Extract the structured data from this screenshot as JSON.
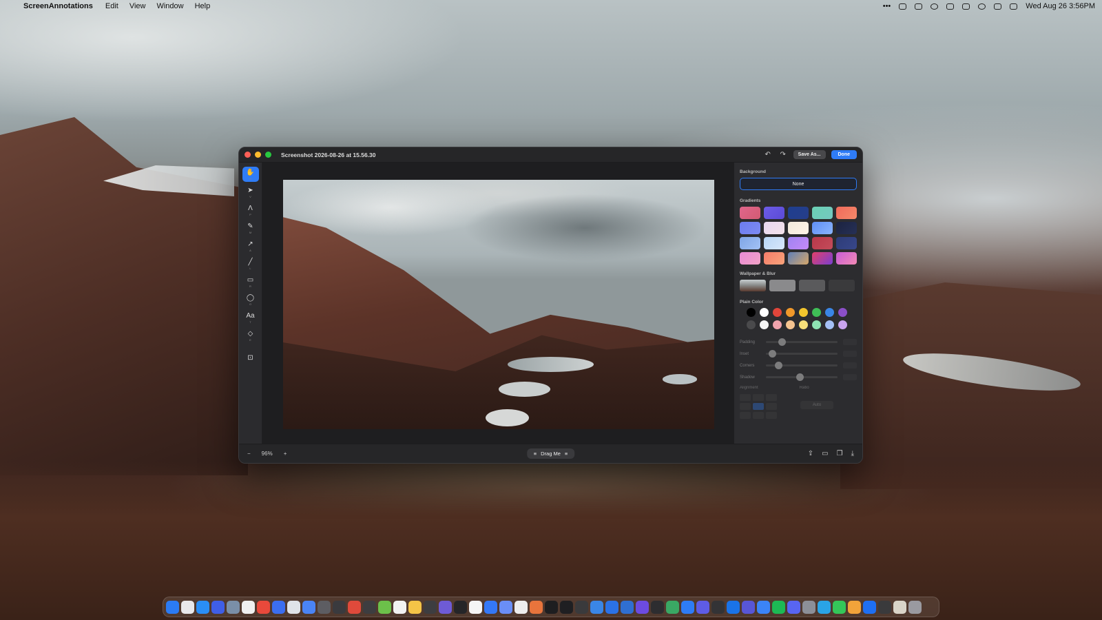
{
  "menubar": {
    "app_name": "ScreenAnnotations",
    "menus": [
      "Edit",
      "View",
      "Window",
      "Help"
    ],
    "clock": "Wed Aug 26  3:56PM",
    "ellipsis": "•••"
  },
  "window": {
    "title": "Screenshot 2026-08-26 at 15.56.30",
    "undo_icon": "↶",
    "redo_icon": "↷",
    "save_as_label": "Save As...",
    "done_label": "Done"
  },
  "tools": [
    {
      "name": "hand-tool",
      "glyph": "✋",
      "key": "H"
    },
    {
      "name": "select-tool",
      "glyph": "➤",
      "key": "V"
    },
    {
      "name": "pen-tool",
      "glyph": "Ʌ",
      "key": "P"
    },
    {
      "name": "pencil-tool",
      "glyph": "✎",
      "key": "M"
    },
    {
      "name": "arrow-tool",
      "glyph": "↗",
      "key": "A"
    },
    {
      "name": "line-tool",
      "glyph": "╱",
      "key": "L"
    },
    {
      "name": "rectangle-tool",
      "glyph": "▭",
      "key": "R"
    },
    {
      "name": "circle-tool",
      "glyph": "◯",
      "key": "O"
    },
    {
      "name": "text-tool",
      "glyph": "Aa",
      "key": "T"
    },
    {
      "name": "eraser-tool",
      "glyph": "◇",
      "key": "E"
    },
    {
      "name": "capture-tool",
      "glyph": "⊡",
      "key": ""
    }
  ],
  "panel": {
    "background_label": "Background",
    "none_label": "None",
    "gradients_label": "Gradients",
    "wallpaper_label": "Wallpaper & Blur",
    "plain_color_label": "Plain Color",
    "sliders": [
      {
        "label": "Padding",
        "value": 0.2
      },
      {
        "label": "Inset",
        "value": 0.05
      },
      {
        "label": "Corners",
        "value": 0.15
      },
      {
        "label": "Shadow",
        "value": 0.5
      }
    ],
    "alignment_label": "Alignment",
    "ratio_label": "Ratio",
    "ratio_value": "Auto",
    "gradients": [
      "linear-gradient(135deg,#e0668c,#d25b72)",
      "linear-gradient(135deg,#6c5ce7,#5b4ad6)",
      "linear-gradient(135deg,#1f3f8f,#263d8a)",
      "linear-gradient(135deg,#6ad0b4,#75c8c0)",
      "linear-gradient(135deg,#f06a5b,#f5896a)",
      "linear-gradient(135deg,#6c7cf0,#7d8bf2)",
      "linear-gradient(135deg,#e8d8f0,#f3e2ea)",
      "linear-gradient(135deg,#f1e9dc,#fff3e6)",
      "linear-gradient(135deg,#5f8ef4,#8ab4ff)",
      "linear-gradient(135deg,#1c2340,#263056)",
      "linear-gradient(135deg,#7fa5e6,#a3c2f5)",
      "linear-gradient(135deg,#b9d6f5,#d8e7fb)",
      "linear-gradient(135deg,#a083f2,#c58af7)",
      "linear-gradient(135deg,#b8384a,#c44c5a)",
      "linear-gradient(135deg,#2d3c78,#38478a)",
      "linear-gradient(135deg,#e98ad6,#f2a2c6)",
      "linear-gradient(135deg,#f47c6a,#f9a37a)",
      "linear-gradient(135deg,#5f7fb8,#d6a76a)",
      "linear-gradient(135deg,#e2406a,#7a3fd0)",
      "linear-gradient(135deg,#c85cd6,#f28ab4)"
    ],
    "wallpapers": [
      "linear-gradient(180deg,#c8ced0 0%,#8c8f8e 45%,#5a3a2f 100%)",
      "#8a8a8c",
      "#5a5a5c",
      "#3a3a3c"
    ],
    "plain_colors": [
      "#000000",
      "#ffffff",
      "#e0453a",
      "#f0982a",
      "#f2c52d",
      "#3fbe56",
      "#3a86e6",
      "#8b4fc8",
      "#4a4a4c",
      "#f5f5f5",
      "#f0a3ad",
      "#f5c490",
      "#f7e07a",
      "#8ee3b3",
      "#a4c0f6",
      "#c9a4ef"
    ]
  },
  "bottombar": {
    "zoom_out": "−",
    "zoom_level": "96%",
    "zoom_in": "+",
    "drag_label": "Drag Me"
  },
  "dock": {
    "apps": [
      "#2b7bf4",
      "#e8e8ea",
      "#2a8ef5",
      "#3f5ee6",
      "#7a8fa8",
      "#f0f0f0",
      "#e9493b",
      "#3b6ef0",
      "#dfe3e8",
      "#4a84f5",
      "#5d5d62",
      "#3a3a3e",
      "#e04a3b",
      "#3d3d40",
      "#6cc04a",
      "#f2f2f2",
      "#f4c447",
      "#3d3d40",
      "#6e5bd6",
      "#252528",
      "#f5f5f5",
      "#3478f6",
      "#6a8ef6",
      "#ededed",
      "#e8743c",
      "#1e1e20",
      "#1f1f22",
      "#3a3a3c",
      "#3a86e6",
      "#2b72e6",
      "#2f6fd1",
      "#6c4be0",
      "#2d2d30",
      "#3aa864",
      "#2e7cf6",
      "#5e5ce6",
      "#333336",
      "#1a73e8",
      "#5856d6",
      "#3b84f7",
      "#1db954",
      "#5865f2",
      "#8c8f98",
      "#2aa4e6",
      "#34c759",
      "#f2a33a",
      "#1e6ff2",
      "#3a3a3c",
      "#d9d4c8",
      "#9a9aa0"
    ]
  }
}
